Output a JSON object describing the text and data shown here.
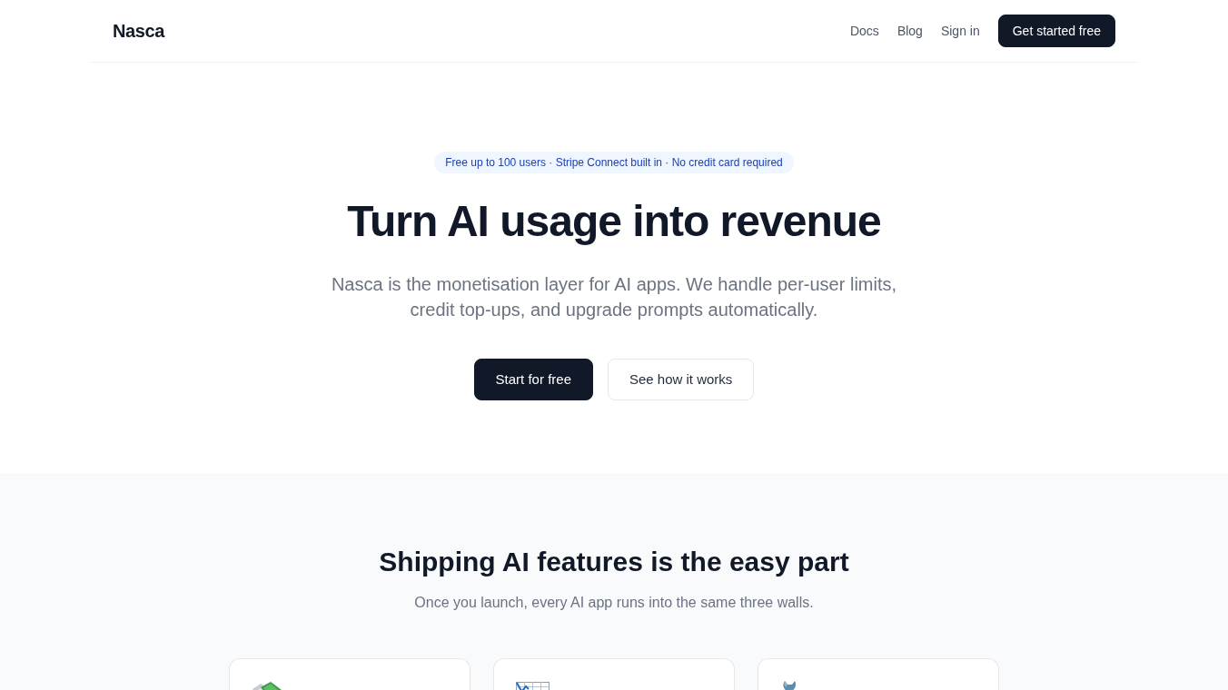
{
  "nav": {
    "brand": "Nasca",
    "links": [
      "Docs",
      "Blog",
      "Sign in"
    ],
    "cta": "Get started free"
  },
  "hero": {
    "badge": "Free up to 100 users · Stripe Connect built in · No credit card required",
    "title": "Turn AI usage into revenue",
    "subtitle": "Nasca is the monetisation layer for AI apps. We handle per-user limits, credit top-ups, and upgrade prompts automatically.",
    "buttons": [
      {
        "label": "Start for free",
        "kind": "primary"
      },
      {
        "label": "See how it works",
        "kind": "secondary"
      }
    ]
  },
  "problems": {
    "title": "Shipping AI features is the easy part",
    "subtitle": "Once you launch, every AI app runs into the same three walls.",
    "cards": [
      {
        "kind": "money"
      },
      {
        "kind": "chart"
      },
      {
        "kind": "wrench"
      }
    ]
  }
}
